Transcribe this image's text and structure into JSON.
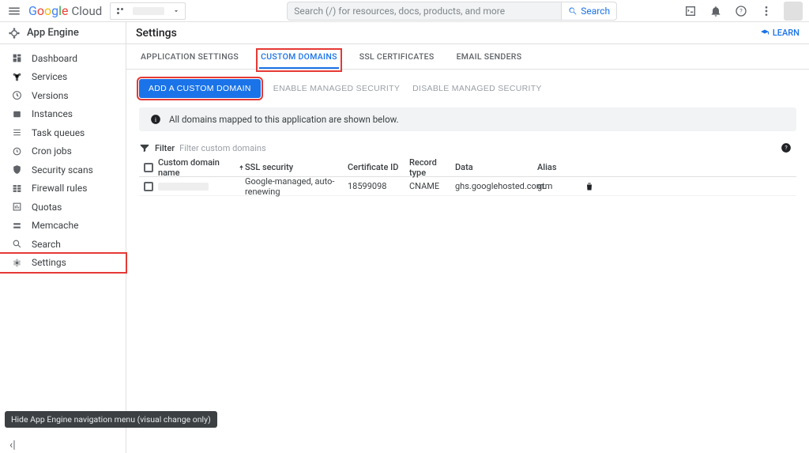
{
  "brand": {
    "cloud_text": "Cloud"
  },
  "search": {
    "placeholder": "Search (/) for resources, docs, products, and more",
    "button": "Search"
  },
  "product": {
    "name": "App Engine"
  },
  "sidebar": {
    "items": [
      {
        "label": "Dashboard"
      },
      {
        "label": "Services"
      },
      {
        "label": "Versions"
      },
      {
        "label": "Instances"
      },
      {
        "label": "Task queues"
      },
      {
        "label": "Cron jobs"
      },
      {
        "label": "Security scans"
      },
      {
        "label": "Firewall rules"
      },
      {
        "label": "Quotas"
      },
      {
        "label": "Memcache"
      },
      {
        "label": "Search"
      },
      {
        "label": "Settings"
      }
    ]
  },
  "page": {
    "title": "Settings",
    "learn": "LEARN"
  },
  "tabs": [
    {
      "label": "APPLICATION SETTINGS"
    },
    {
      "label": "CUSTOM DOMAINS"
    },
    {
      "label": "SSL CERTIFICATES"
    },
    {
      "label": "EMAIL SENDERS"
    }
  ],
  "actions": {
    "add_domain": "ADD A CUSTOM DOMAIN",
    "enable_managed": "ENABLE MANAGED SECURITY",
    "disable_managed": "DISABLE MANAGED SECURITY"
  },
  "info_bar": "All domains mapped to this application are shown below.",
  "filter": {
    "label": "Filter",
    "placeholder": "Filter custom domains"
  },
  "table": {
    "headers": {
      "domain": "Custom domain name",
      "ssl": "SSL security",
      "cert": "Certificate ID",
      "record": "Record type",
      "data": "Data",
      "alias": "Alias"
    },
    "rows": [
      {
        "ssl": "Google-managed, auto-renewing",
        "cert": "18599098",
        "record": "CNAME",
        "data": "ghs.googlehosted.com.",
        "alias": "gtm"
      }
    ]
  },
  "tooltip": "Hide App Engine navigation menu (visual change only)"
}
